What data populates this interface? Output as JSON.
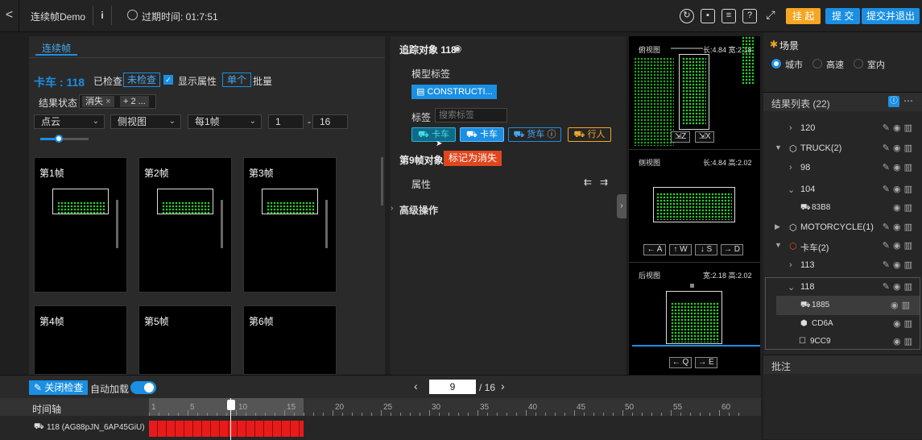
{
  "topbar": {
    "back": "<",
    "app_name": "连续帧Demo",
    "info": "i",
    "expire_label": "过期时间: 01:7:51",
    "suspend": "挂 起",
    "submit": "提 交",
    "submit_exit": "提交并退出"
  },
  "left": {
    "tab": "连续帧",
    "category": "卡车 : 118",
    "checked": "已检查",
    "unchecked": "未检查",
    "show_attr": "显示属性",
    "single": "单个",
    "batch": "批量",
    "result_state": "结果状态",
    "chip1": "消失",
    "chip1_close": "×",
    "chip2": "+ 2 ...",
    "select_cloud": "点云",
    "select_view": "侧视图",
    "select_every": "每1帧",
    "range_from": "1",
    "range_sep": "-",
    "range_to": "16",
    "frames": [
      "第1帧",
      "第2帧",
      "第3帧",
      "第4帧",
      "第5帧",
      "第6帧"
    ]
  },
  "mid": {
    "track_title": "追踪对象 118",
    "model_tag_label": "模型标签",
    "model_tag_btn": "CONSTRUCTI...",
    "tag_label": "标签",
    "tag_search_placeholder": "搜索标签",
    "tag_tags": [
      "卡车",
      "卡车",
      "货车",
      "行人"
    ],
    "frame_obj": "第9帧对象",
    "mark_disappear": "标记为消失",
    "attr": "属性",
    "advanced": "高级操作"
  },
  "views": {
    "top_label": "俯视图",
    "top_size": "长:4.84 宽:2.18",
    "side_label": "侧视图",
    "side_size": "长:4.84 高:2.02",
    "back_label": "后视图",
    "back_size": "宽:2.18 高:2.02",
    "btn_z": "Z",
    "btn_x": "X",
    "btn_a": "A",
    "btn_w": "W",
    "btn_s": "S",
    "btn_d": "D",
    "btn_q": "Q",
    "btn_e": "E"
  },
  "right": {
    "scene_title": "场景",
    "scene_options": [
      "城市",
      "高速",
      "室内"
    ],
    "results_title": "结果列表 (22)",
    "tree": [
      "120",
      "TRUCK(2)",
      "98",
      "104",
      "83B8",
      "MOTORCYCLE(1)",
      "卡车(2)",
      "113",
      "118",
      "1885",
      "CD6A",
      "9CC9"
    ],
    "notes": "批注"
  },
  "bottom": {
    "close_check": "关闭检查",
    "auto_load": "自动加载",
    "page_current": "9",
    "page_total": "/ 16",
    "timeline": "时间轴",
    "track_name": "118 (AG88pJN_6AP45GiU)",
    "ticks": [
      "1",
      "5",
      "10",
      "15",
      "20",
      "25",
      "30",
      "35",
      "40",
      "45",
      "50",
      "55",
      "60"
    ]
  },
  "colors": {
    "accent": "#1a8fe3",
    "suspend": "#f5a623",
    "mark": "#e0461e",
    "green": "#2bd32b"
  }
}
